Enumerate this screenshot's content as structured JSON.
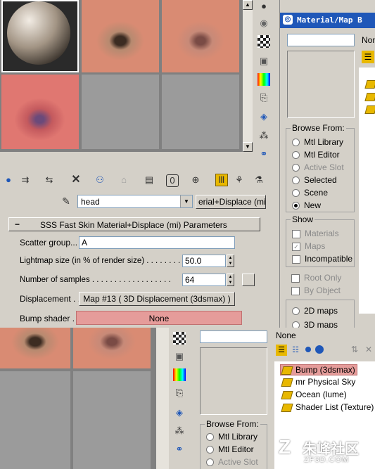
{
  "top_editor": {
    "browser_title": "Material/Map B",
    "browser_top_label": "Non",
    "browse_from": {
      "label": "Browse From:",
      "options": [
        "Mtl Library",
        "Mtl Editor",
        "Active Slot",
        "Selected",
        "Scene",
        "New"
      ],
      "selected": "New"
    },
    "show": {
      "label": "Show",
      "items": [
        {
          "label": "Materials",
          "checked": false,
          "enabled": false
        },
        {
          "label": "Maps",
          "checked": true,
          "enabled": false
        },
        {
          "label": "Incompatible",
          "checked": false,
          "enabled": true
        }
      ],
      "root_only": "Root Only",
      "by_object": "By Object"
    },
    "map_radios": [
      "2D maps",
      "3D maps"
    ]
  },
  "name_row": {
    "material_name": "head",
    "type_button": "erial+Displace (mi)"
  },
  "rollout": {
    "title": "SSS Fast Skin Material+Displace (mi) Parameters",
    "collapse": "−",
    "scatter_label": "Scatter group...",
    "scatter_value": "A",
    "lightmap_label": "Lightmap size (in % of render size) . . . . . . . . .",
    "lightmap_value": "50.0",
    "samples_label": "Number of samples . . . . . . . . . . . . . . . . . .",
    "samples_value": "64",
    "displacement_label": "Displacement . .",
    "displacement_value": "Map #13  ( 3D Displacement (3dsmax) )",
    "bump_label": "Bump shader . .",
    "bump_value": "None"
  },
  "bottom_browser": {
    "none_label": "None",
    "browse_from_label": "Browse From:",
    "browse_options": [
      "Mtl Library",
      "Mtl Editor",
      "Active Slot"
    ],
    "map_list": [
      {
        "label": "Bump (3dsmax)",
        "highlighted": true
      },
      {
        "label": "mr Physical Sky",
        "highlighted": false
      },
      {
        "label": "Ocean (lume)",
        "highlighted": false
      },
      {
        "label": "Shader List (Texture)",
        "highlighted": false
      }
    ]
  },
  "watermark": {
    "text_cn": "朱峰社区",
    "text_url": "ZF3D.COM"
  },
  "colors": {
    "highlight": "#e59c9a",
    "accent_blue": "#1f57b8",
    "skin": "#d98b73",
    "slot_grey": "#9b9b9b"
  }
}
